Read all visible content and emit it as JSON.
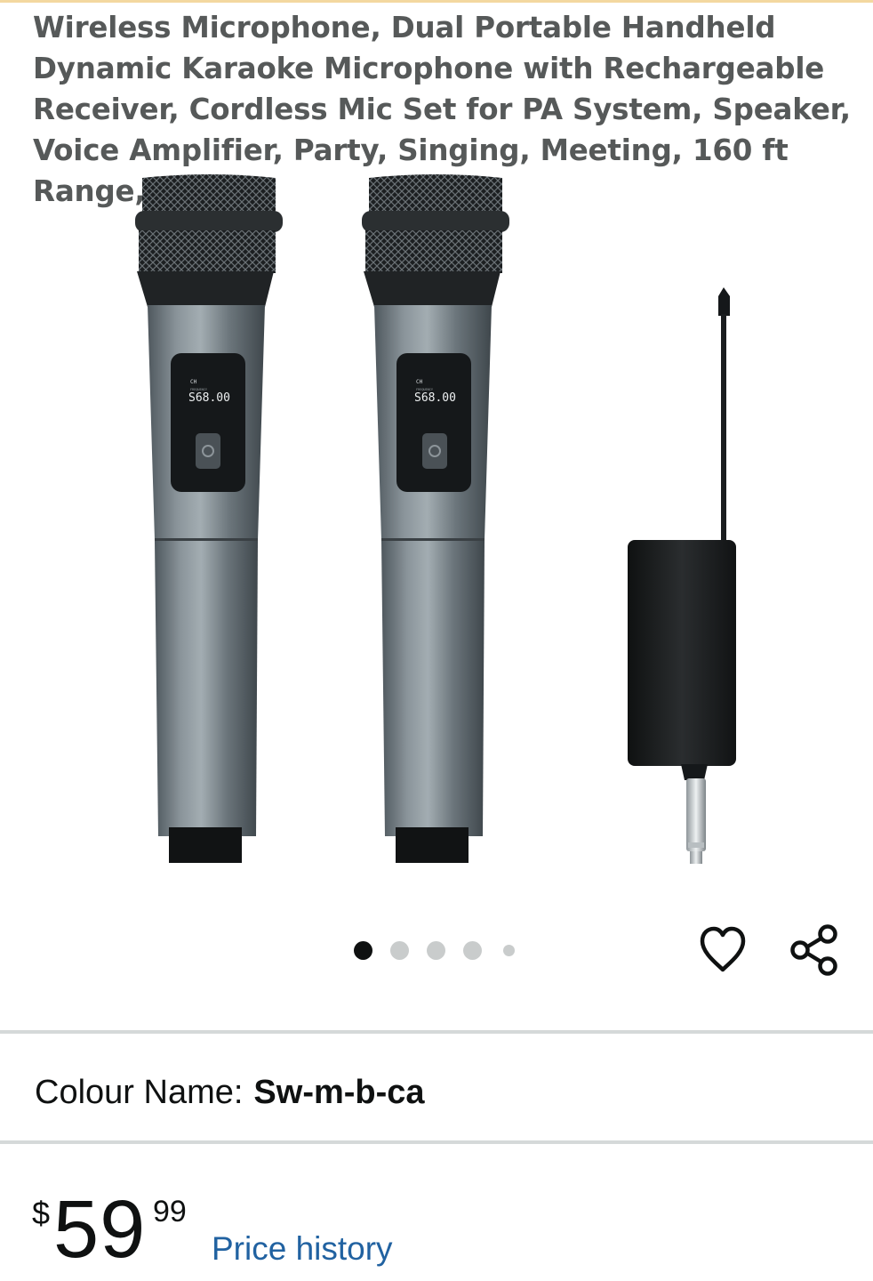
{
  "product": {
    "title": "Wireless Microphone, Dual Portable Handheld Dynamic Karaoke Microphone with Rechargeable Receiver, Cordless Mic Set for PA System, Speaker, Voice Amplifier, Party, Singing, Meeting, 160 ft Range, Gray",
    "display_text": "S68.00",
    "display_ch": "CH",
    "display_freq": "FREQUENCY"
  },
  "gallery": {
    "image_count": 5,
    "active_index": 0
  },
  "variant": {
    "label": "Colour Name:",
    "value": "Sw-m-b-ca"
  },
  "price": {
    "currency": "$",
    "whole": "59",
    "fraction": "99",
    "history_link": "Price history"
  },
  "colors": {
    "link": "#2162a1",
    "divider": "#d5d9d9",
    "accent": "#f3d8a0"
  },
  "icons": {
    "wishlist": "heart-outline-icon",
    "share": "share-icon"
  }
}
